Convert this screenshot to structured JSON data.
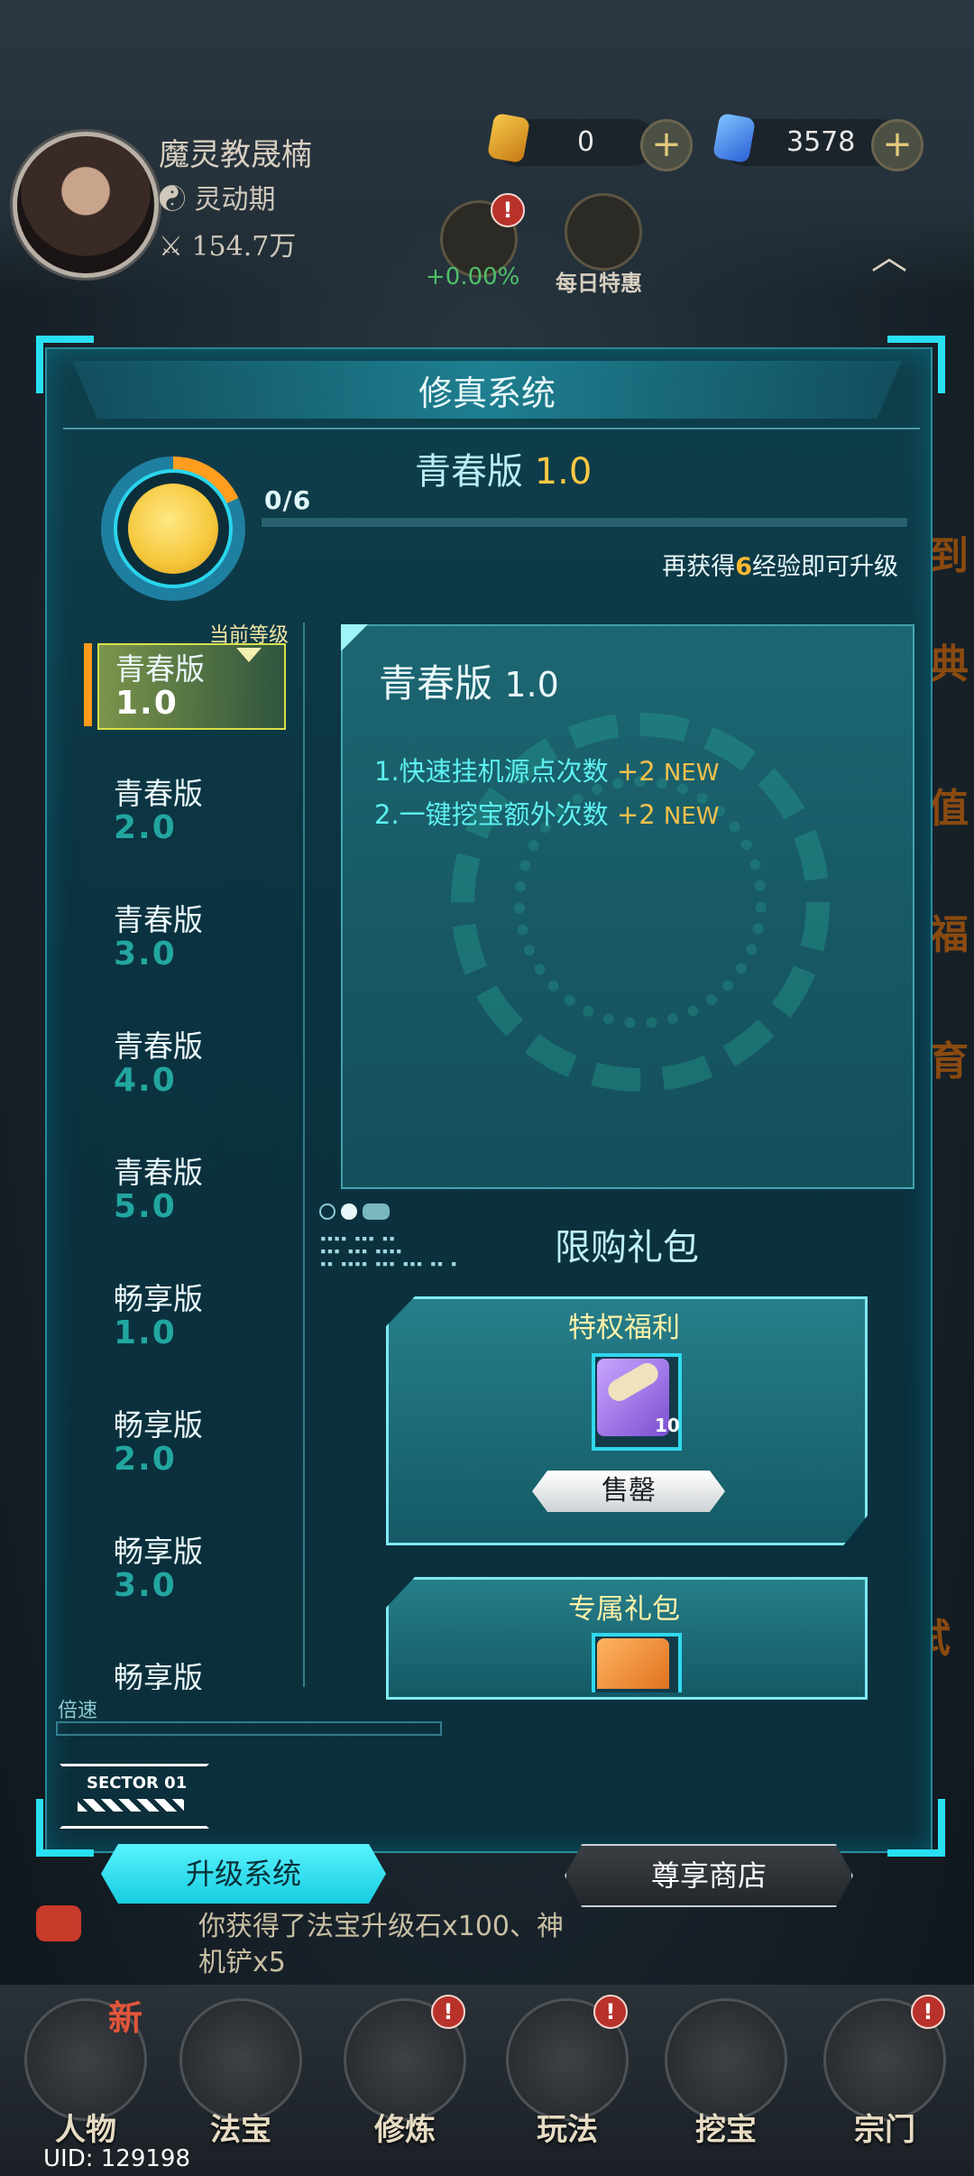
{
  "player": {
    "name": "魔灵教晟楠",
    "realm": "灵动期",
    "power": "154.7万"
  },
  "currency": {
    "gold": "0",
    "crystal": "3578"
  },
  "hud": {
    "exp_rate": "+0.00%",
    "daily_deal": "每日特惠"
  },
  "dialog": {
    "title": "修真系统",
    "version_label": "青春版",
    "version_num": "1.0",
    "progress_text": "0/6",
    "progress": 0.0,
    "exp_tip_pre": "再获得",
    "exp_tip_num": "6",
    "exp_tip_post": "经验即可升级",
    "current_tag": "当前等级",
    "levels": [
      {
        "name": "青春版",
        "version": "1.0"
      },
      {
        "name": "青春版",
        "version": "2.0"
      },
      {
        "name": "青春版",
        "version": "3.0"
      },
      {
        "name": "青春版",
        "version": "4.0"
      },
      {
        "name": "青春版",
        "version": "5.0"
      },
      {
        "name": "畅享版",
        "version": "1.0"
      },
      {
        "name": "畅享版",
        "version": "2.0"
      },
      {
        "name": "畅享版",
        "version": "3.0"
      },
      {
        "name": "畅享版",
        "version": ""
      }
    ],
    "detail": {
      "name": "青春版",
      "num": "1.0",
      "perks": [
        {
          "text": "1.快速挂机源点次数",
          "plus": "+2",
          "new": "NEW"
        },
        {
          "text": "2.一键挖宝额外次数",
          "plus": "+2",
          "new": "NEW"
        }
      ]
    },
    "gift_heading": "限购礼包",
    "cards": [
      {
        "title": "特权福利",
        "count": "10",
        "button": "售罄"
      },
      {
        "title": "专属礼包"
      }
    ],
    "speed_label": "倍速",
    "sector": "SECTOR 01",
    "tabs": {
      "upgrade": "升级系统",
      "shop": "尊享商店"
    }
  },
  "chat": {
    "line1_pre": "你获得了法宝升级石x100、神",
    "line2": "机铲x5"
  },
  "nav": [
    "人物",
    "法宝",
    "修炼",
    "玩法",
    "挖宝",
    "宗门"
  ],
  "new_badge": "新",
  "uid": "UID: 129198",
  "colors": {
    "accent": "#28e0f2",
    "orange": "#ff9b1a",
    "gold": "#ffc843"
  }
}
